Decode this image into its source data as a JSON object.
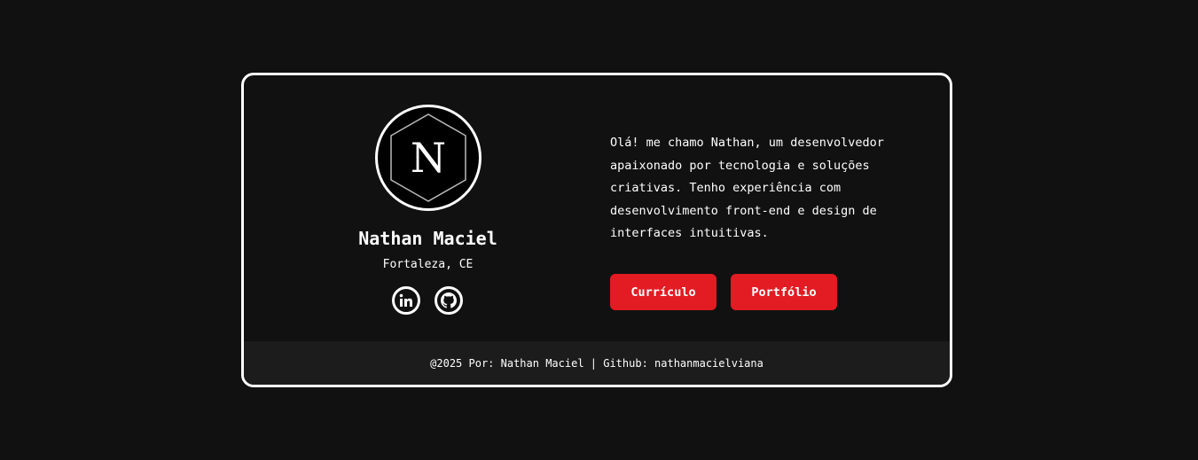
{
  "profile": {
    "initial": "N",
    "name": "Nathan Maciel",
    "location": "Fortaleza, CE",
    "socials": [
      {
        "icon": "linkedin-icon",
        "label": "in"
      },
      {
        "icon": "github-icon"
      }
    ]
  },
  "bio": {
    "text": "Olá! me chamo Nathan, um desenvolvedor\napaixonado por tecnologia e soluções\ncriativas. Tenho experiência com\ndesenvolvimento front-end e design de\ninterfaces intuitivas."
  },
  "actions": {
    "resume_label": "Currículo",
    "portfolio_label": "Portfólio"
  },
  "footer": {
    "text": "@2025 Por: Nathan Maciel | Github: nathanmacielviana"
  },
  "colors": {
    "background": "#111111",
    "accent": "#e31b23",
    "footer_bg": "#1c1c1c",
    "border": "#ffffff"
  }
}
